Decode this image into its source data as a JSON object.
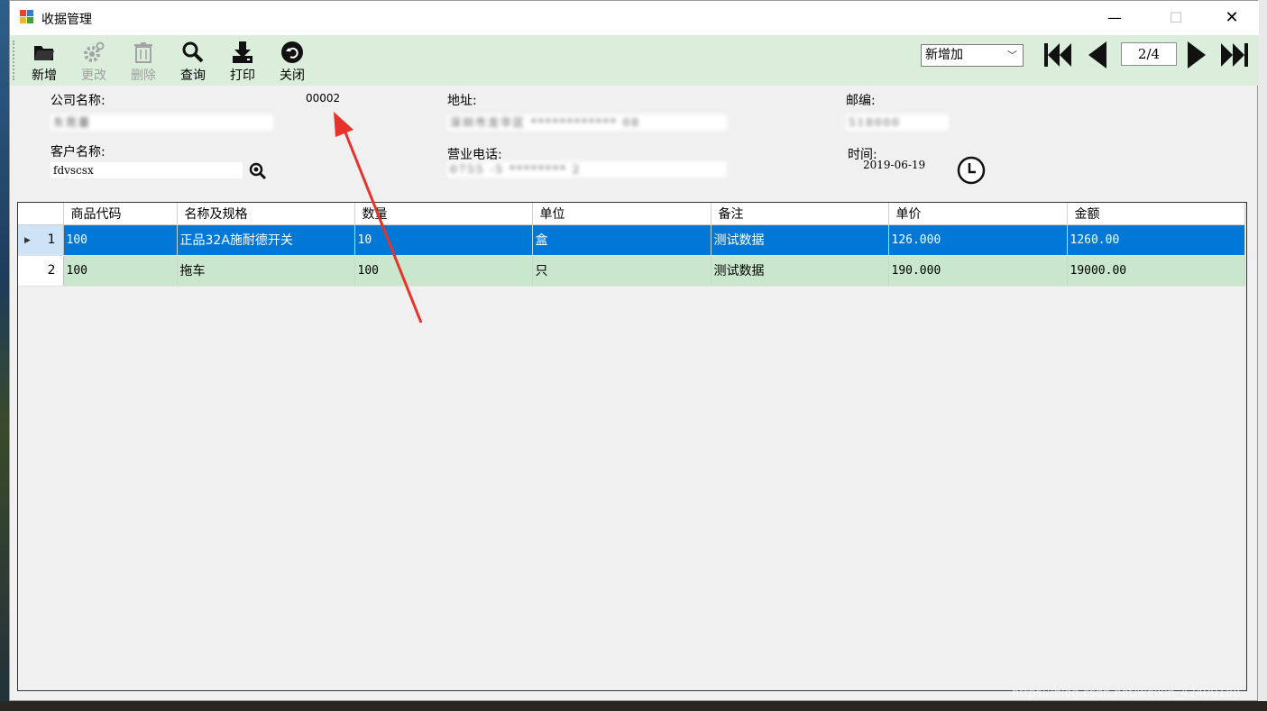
{
  "window": {
    "title": "收据管理",
    "controls": {
      "minimize": "—",
      "maximize": "☐",
      "close": "✕"
    }
  },
  "toolbar": {
    "buttons": [
      {
        "label": "新增",
        "icon": "folder-icon",
        "enabled": true
      },
      {
        "label": "更改",
        "icon": "gear-icon",
        "enabled": false
      },
      {
        "label": "删除",
        "icon": "trash-icon",
        "enabled": false
      },
      {
        "label": "查询",
        "icon": "search-icon",
        "enabled": true
      },
      {
        "label": "打印",
        "icon": "download-icon",
        "enabled": true
      },
      {
        "label": "关闭",
        "icon": "undo-icon",
        "enabled": true
      }
    ],
    "mode_select": {
      "value": "新增加"
    },
    "pager": {
      "current": "2/4"
    }
  },
  "form": {
    "company_label": "公司名称:",
    "company_value": "东莞蔓",
    "code": "00002",
    "address_label": "地址:",
    "address_value": "深圳市龙华区 ************ 08",
    "postcode_label": "邮编:",
    "postcode_value": "518000",
    "customer_label": "客户名称:",
    "customer_value": "fdvscsx",
    "phone_label": "营业电话:",
    "phone_value": "0755 -5 ******** 2",
    "time_label": "时间:",
    "time_value": "2019-06-19"
  },
  "grid": {
    "columns": [
      "商品代码",
      "名称及规格",
      "数量",
      "单位",
      "备注",
      "单价",
      "金额"
    ],
    "rows": [
      {
        "index": "1",
        "code": "100",
        "name": "正品32A施耐德开关",
        "qty": "10",
        "unit": "盒",
        "note": "测试数据",
        "price": "126.000",
        "amount": "1260.00",
        "selected": true
      },
      {
        "index": "2",
        "code": "100",
        "name": "拖车",
        "qty": "100",
        "unit": "只",
        "note": "测试数据",
        "price": "190.000",
        "amount": "19000.00",
        "selected": false
      }
    ]
  },
  "watermark": "https://blog.csdn.net/weixin_42400188",
  "colors": {
    "toolbar_bg": "#dbeedc",
    "selected_row": "#0078d7",
    "alt_row": "#c9e7cc",
    "arrow": "#e8322a"
  }
}
